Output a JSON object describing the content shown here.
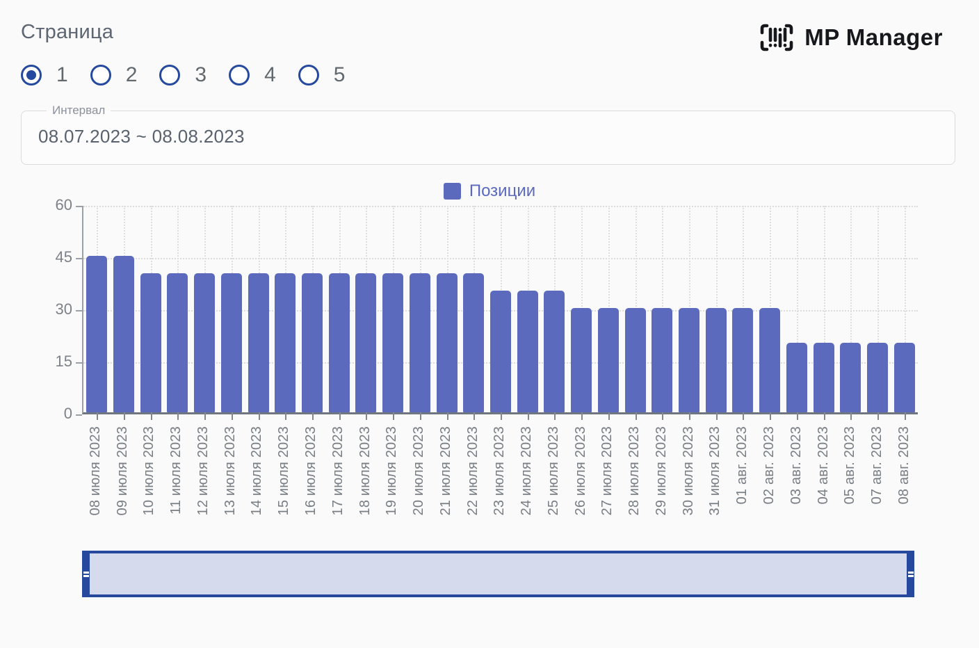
{
  "page": {
    "title": "Страница"
  },
  "brand": {
    "name": "MP Manager",
    "icon": "barcode-scan-icon"
  },
  "pagination": {
    "options": [
      "1",
      "2",
      "3",
      "4",
      "5"
    ],
    "selected": "1"
  },
  "interval": {
    "label": "Интервал",
    "value": "08.07.2023 ~ 08.08.2023"
  },
  "colors": {
    "accent_navy": "#26499e",
    "bar": "#5c6abe",
    "legend_text": "#5b69be",
    "scrollbar_fill": "#d5dbec",
    "axis_gray": "#9aa0a6"
  },
  "chart_data": {
    "type": "bar",
    "title": "",
    "legend": [
      "Позиции"
    ],
    "legend_position": "top",
    "categories": [
      "08 июля 2023",
      "09 июля 2023",
      "10 июля 2023",
      "11 июля 2023",
      "12 июля 2023",
      "13 июля 2023",
      "14 июля 2023",
      "15 июля 2023",
      "16 июля 2023",
      "17 июля 2023",
      "18 июля 2023",
      "19 июля 2023",
      "20 июля 2023",
      "21 июля 2023",
      "22 июля 2023",
      "23 июля 2023",
      "24 июля 2023",
      "25 июля 2023",
      "26 июля 2023",
      "27 июля 2023",
      "28 июля 2023",
      "29 июля 2023",
      "30 июля 2023",
      "31 июля 2023",
      "01 авг. 2023",
      "02 авг. 2023",
      "03 авг. 2023",
      "04 авг. 2023",
      "05 авг. 2023",
      "07 авг. 2023",
      "08 авг. 2023"
    ],
    "values": [
      45,
      45,
      40,
      40,
      40,
      40,
      40,
      40,
      40,
      40,
      40,
      40,
      40,
      40,
      40,
      35,
      35,
      35,
      30,
      30,
      30,
      30,
      30,
      30,
      30,
      30,
      20,
      20,
      20,
      20,
      20
    ],
    "series_name": "Позиции",
    "ylim": [
      0,
      60
    ],
    "yticks": [
      0,
      15,
      30,
      45,
      60
    ],
    "grid": true,
    "xlabel": "",
    "ylabel": ""
  }
}
